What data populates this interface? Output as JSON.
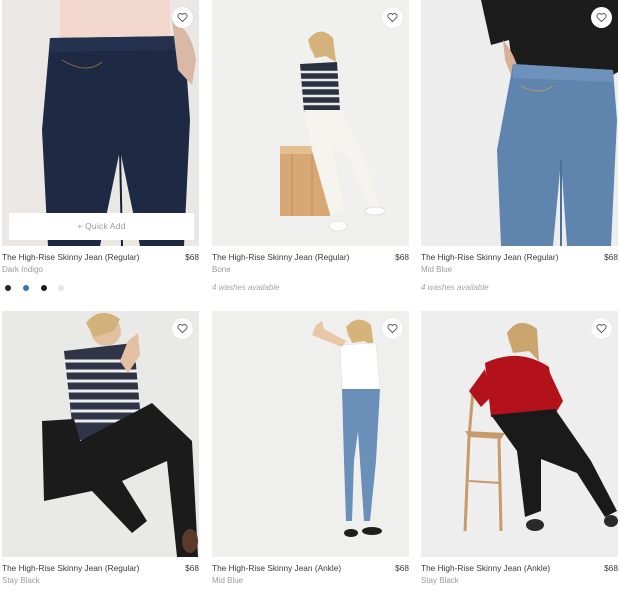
{
  "quick_add_label": "+ Quick Add",
  "products": [
    {
      "name": "The High-Rise Skinny Jean (Regular)",
      "price": "$68",
      "color": "Dark Indigo",
      "note": "",
      "swatches": [
        "#1c2433",
        "#3f6fb5",
        "#1a1a1a",
        "#e6e6e6"
      ]
    },
    {
      "name": "The High-Rise Skinny Jean (Regular)",
      "price": "$68",
      "color": "Bone",
      "note": "4 washes available"
    },
    {
      "name": "The High-Rise Skinny Jean (Regular)",
      "price": "$68",
      "color": "Mid Blue",
      "note": "4 washes available"
    },
    {
      "name": "The High-Rise Skinny Jean (Regular)",
      "price": "$68",
      "color": "Stay Black",
      "note": ""
    },
    {
      "name": "The High-Rise Skinny Jean (Ankle)",
      "price": "$68",
      "color": "Mid Blue",
      "note": ""
    },
    {
      "name": "The High-Rise Skinny Jean (Ankle)",
      "price": "$68",
      "color": "Stay Black",
      "note": ""
    }
  ]
}
